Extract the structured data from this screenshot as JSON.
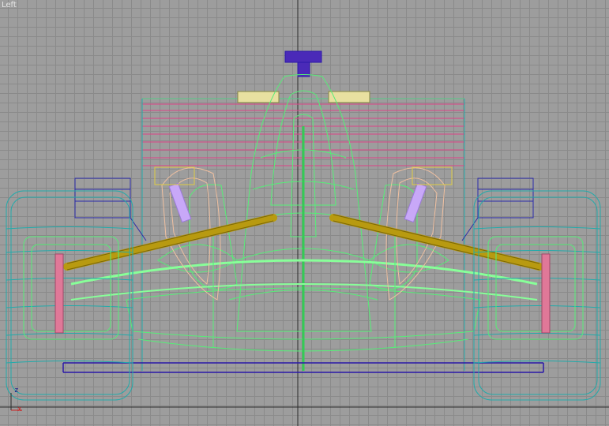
{
  "viewport": {
    "label": "Left",
    "colors": {
      "background": "#9d9d9d",
      "grid": "#8a8a8a",
      "axis": "#2a2a2a",
      "body": "#55ee77",
      "wing": "#dd4488",
      "wheel": "#22aaaa",
      "suspension": "#b89a10",
      "mirror": "#e8e0a0",
      "intake": "#2a18a8",
      "endplate": "#2a2aaa",
      "bargeboard": "#f0c0a0",
      "damper": "#c8a8f8",
      "brake": "#e07898"
    }
  },
  "gizmo": {
    "z_label": "z",
    "x_label": "x"
  }
}
